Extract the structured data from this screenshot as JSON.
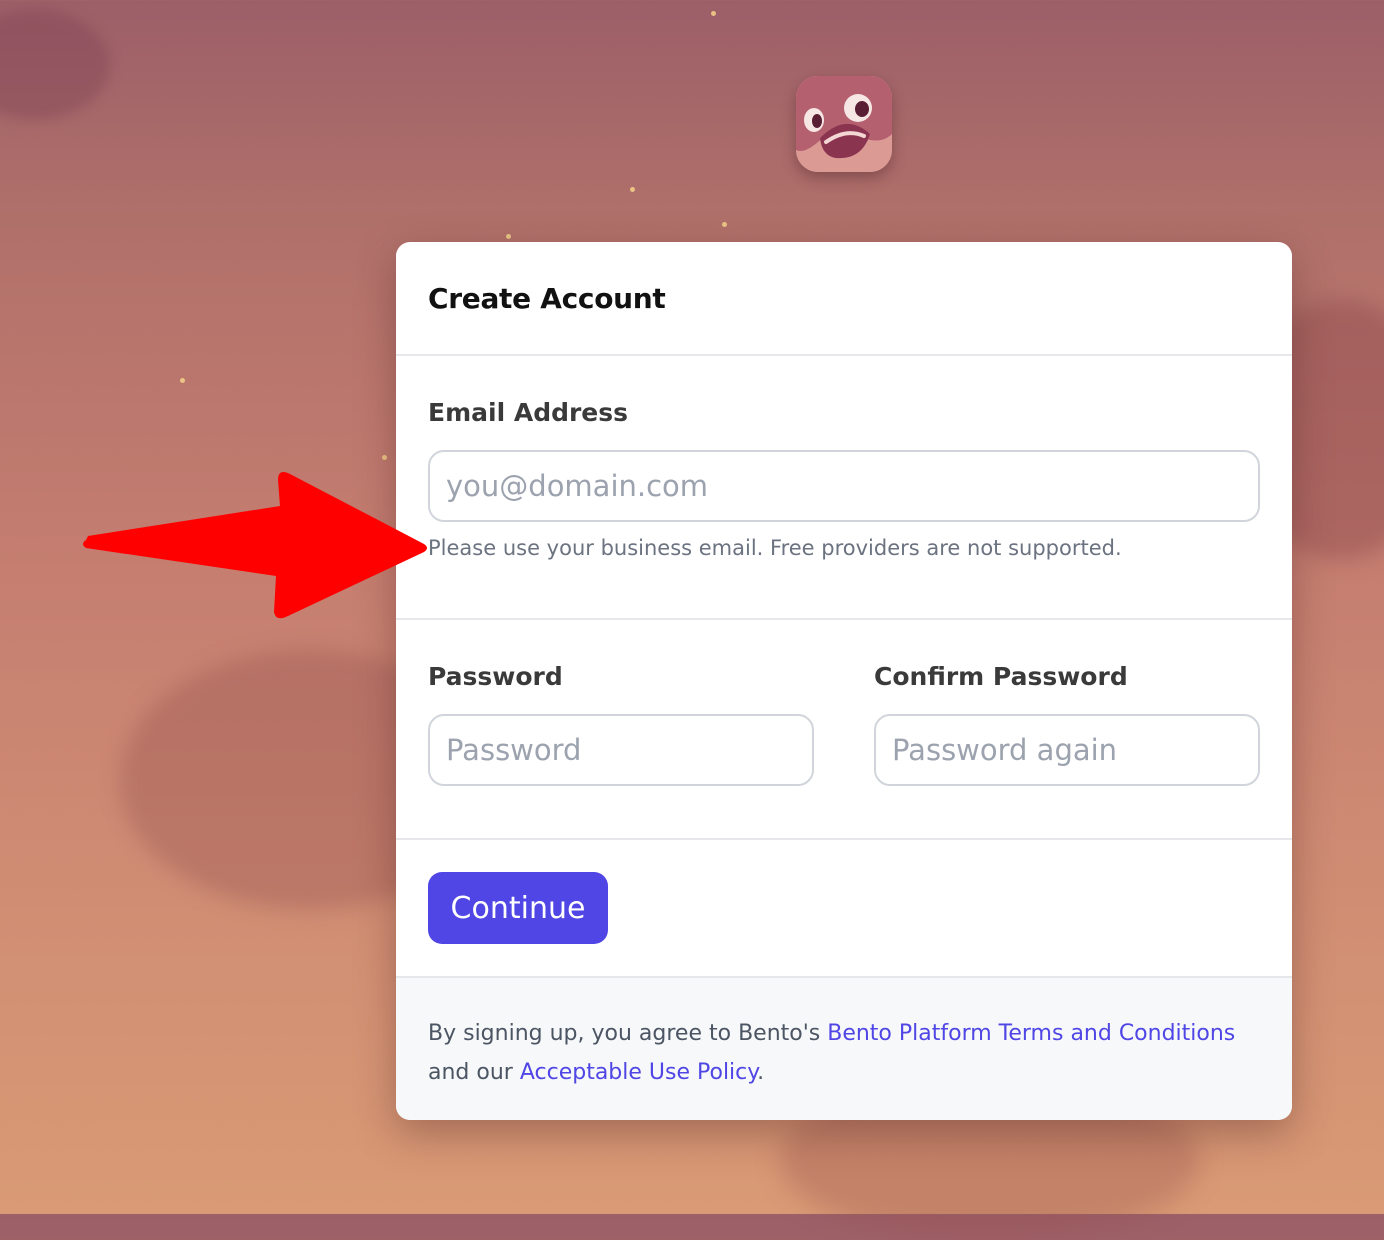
{
  "form": {
    "title": "Create Account",
    "email": {
      "label": "Email Address",
      "placeholder": "you@domain.com",
      "value": "",
      "hint": "Please use your business email. Free providers are not supported."
    },
    "password": {
      "label": "Password",
      "placeholder": "Password",
      "value": ""
    },
    "confirm_password": {
      "label": "Confirm Password",
      "placeholder": "Password again",
      "value": ""
    },
    "submit_label": "Continue"
  },
  "footer": {
    "prefix": "By signing up, you agree to Bento's",
    "terms_link": "Bento Platform Terms and Conditions",
    "middle": "and our",
    "policy_link": "Acceptable Use Policy",
    "suffix": "."
  },
  "colors": {
    "accent": "#4f46e5",
    "arrow": "#ff0000",
    "hint_text": "#6b7280"
  },
  "icons": {
    "logo": "bento-mascot-logo",
    "annotation": "red-arrow-icon"
  }
}
